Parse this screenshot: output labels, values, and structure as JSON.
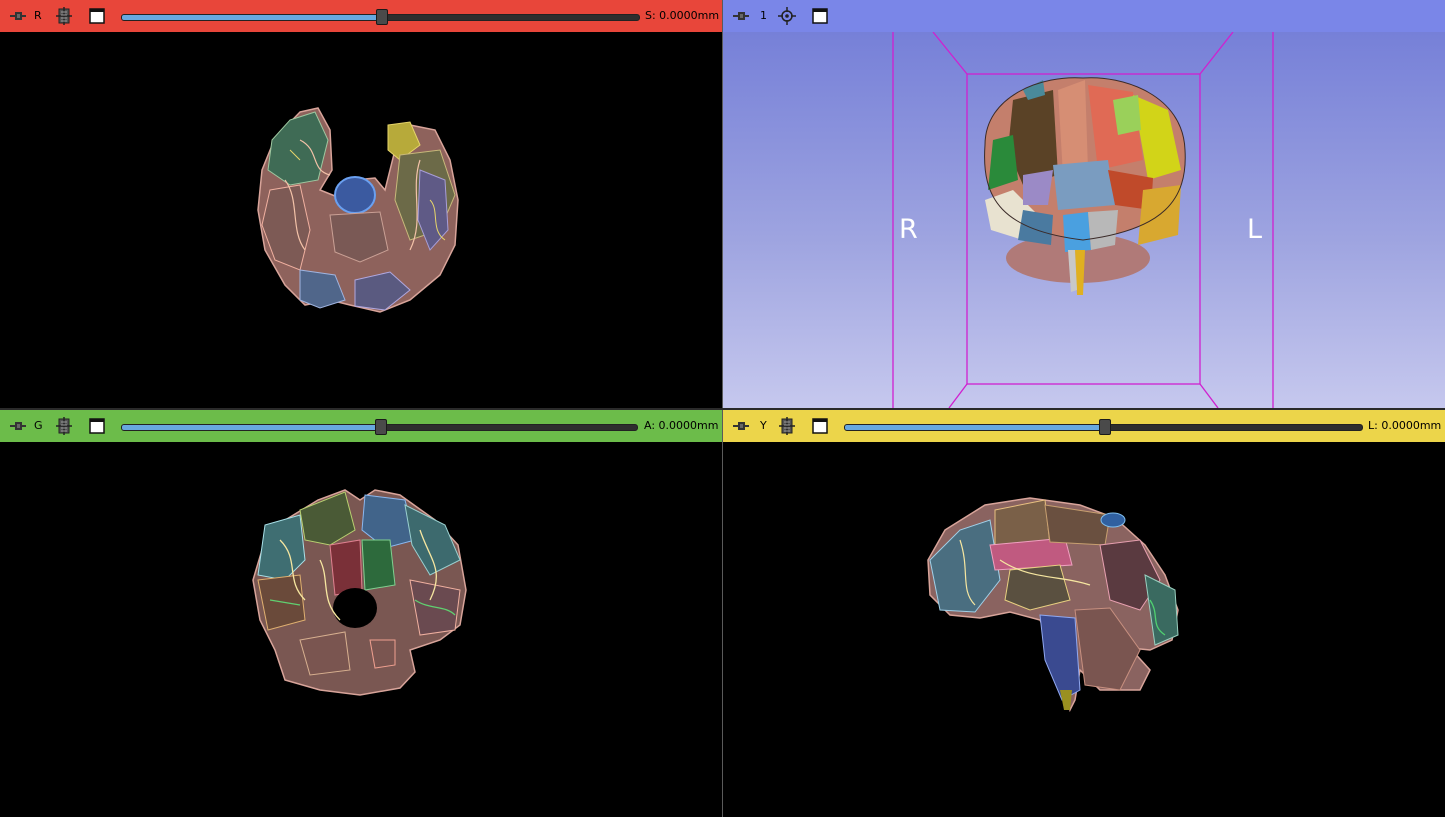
{
  "views": {
    "red": {
      "label": "R",
      "offset": "S: 0.0000mm",
      "color": "#e8463a",
      "slider_fraction": 0.5
    },
    "three_d": {
      "label": "1",
      "color": "#7a86e8",
      "orient_right": "R",
      "orient_left": "L"
    },
    "green": {
      "label": "G",
      "offset": "A: 0.0000mm",
      "color": "#6cbc4a",
      "slider_fraction": 0.5
    },
    "yellow": {
      "label": "Y",
      "offset": "L: 0.0000mm",
      "color": "#ecd54a",
      "slider_fraction": 0.5
    }
  },
  "icons": {
    "pin": "pin-icon",
    "link": "link-icon",
    "center": "center-view-icon",
    "maximize": "maximize-view-icon"
  }
}
